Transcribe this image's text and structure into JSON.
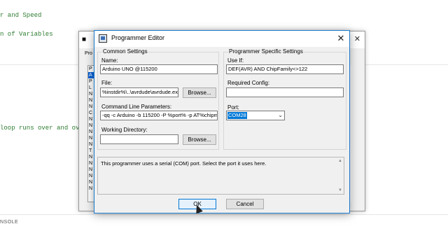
{
  "editor": {
    "lines": [
      "r and Speed",
      "n of Variables",
      "loop runs over and ov"
    ],
    "console_label": "NSOLE"
  },
  "back_window": {
    "icon": "cow-icon",
    "tab_label": "Pro",
    "list_items": [
      "P",
      "A",
      "P",
      "L",
      "N",
      "N",
      "N",
      "C",
      "N",
      "N",
      "N",
      "N",
      "N",
      "T",
      "N",
      "N",
      "N",
      "N",
      "N",
      "N"
    ]
  },
  "dialog": {
    "title": "Programmer Editor",
    "close_symbol": "✕",
    "common": {
      "group_title": "Common Settings",
      "name_label": "Name:",
      "name_value": "Arduino UNO @115200",
      "file_label": "File:",
      "file_value": "%instdir%\\..\\avrdude\\avrdude.ex",
      "browse_label": "Browse...",
      "cmd_label": "Command Line Parameters:",
      "cmd_value": "-qq -c Arduino -b 115200 -P %port% -p AT%chipm",
      "workdir_label": "Working Directory:",
      "workdir_value": "",
      "browse2_label": "Browse..."
    },
    "specific": {
      "group_title": "Programmer Specific Settings",
      "useif_label": "Use If:",
      "useif_value": "DEF(AVR) AND ChipFamily<>122",
      "reqconf_label": "Required Config:",
      "reqconf_value": "",
      "port_label": "Port:",
      "port_value": "COM28"
    },
    "description": "This programmer uses a serial (COM) port. Select the port it uses here.",
    "ok_label": "OK",
    "cancel_label": "Cancel"
  }
}
